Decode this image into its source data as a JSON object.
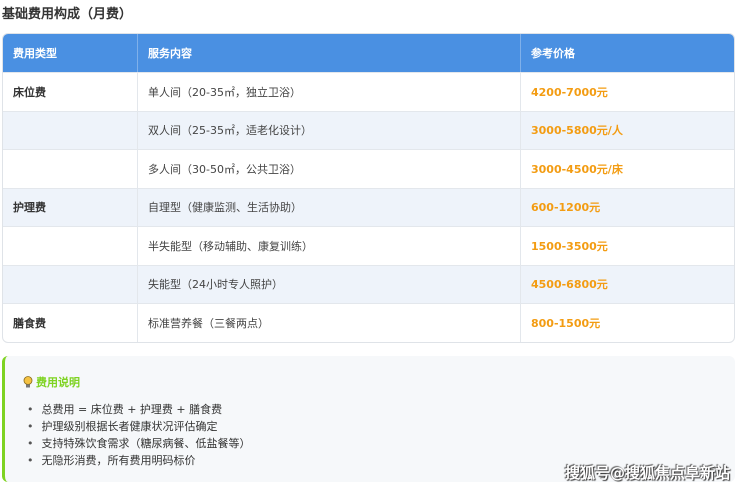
{
  "title": "基础费用构成（月费）",
  "table": {
    "headers": [
      "费用类型",
      "服务内容",
      "参考价格"
    ],
    "rows": [
      {
        "type": "床位费",
        "service": "单人间（20-35㎡，独立卫浴）",
        "price": "4200-7000元"
      },
      {
        "type": "",
        "service": "双人间（25-35㎡，适老化设计）",
        "price": "3000-5800元/人"
      },
      {
        "type": "",
        "service": "多人间（30-50㎡，公共卫浴）",
        "price": "3000-4500元/床"
      },
      {
        "type": "护理费",
        "service": "自理型（健康监测、生活协助）",
        "price": "600-1200元"
      },
      {
        "type": "",
        "service": "半失能型（移动辅助、康复训练）",
        "price": "1500-3500元"
      },
      {
        "type": "",
        "service": "失能型（24小时专人照护）",
        "price": "4500-6800元"
      },
      {
        "type": "膳食费",
        "service": "标准营养餐（三餐两点）",
        "price": "800-1500元"
      }
    ]
  },
  "note": {
    "title": "费用说明",
    "items": [
      "总费用 = 床位费 + 护理费 + 膳食费",
      "护理级别根据长者健康状况评估确定",
      "支持特殊饮食需求（糖尿病餐、低盐餐等）",
      "无隐形消费，所有费用明码标价"
    ]
  },
  "watermark": "搜狐号@搜狐焦点阜新站"
}
